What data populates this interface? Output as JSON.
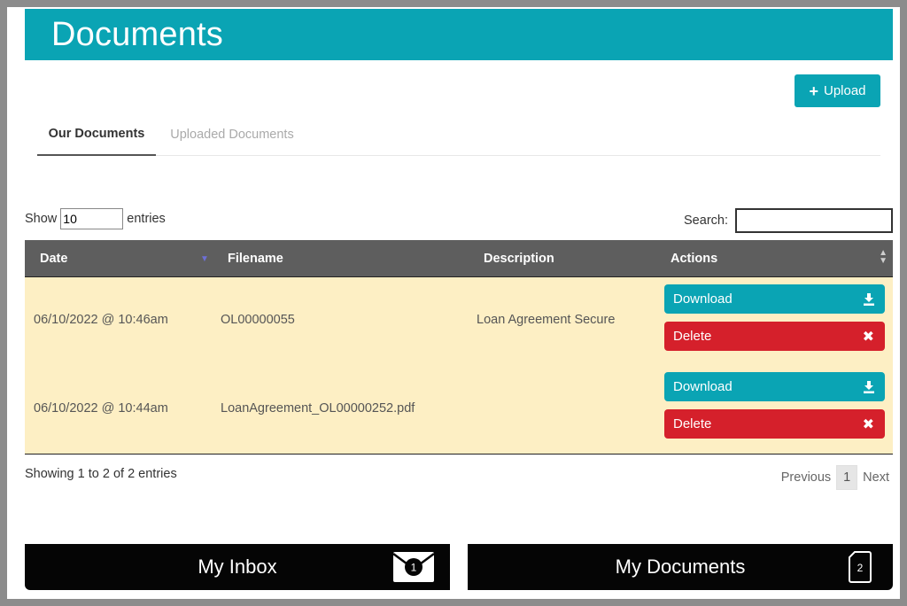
{
  "header": {
    "title": "Documents"
  },
  "toolbar": {
    "upload_label": "Upload",
    "upload_icon": "plus-icon"
  },
  "tabs": [
    {
      "label": "Our Documents",
      "active": true
    },
    {
      "label": "Uploaded Documents",
      "active": false
    }
  ],
  "table_controls": {
    "show_label": "Show",
    "show_value": "10",
    "entries_label": "entries",
    "search_label": "Search:",
    "search_value": ""
  },
  "table": {
    "columns": [
      "Date",
      "Filename",
      "Description",
      "Actions"
    ],
    "rows": [
      {
        "date": "06/10/2022 @ 10:46am",
        "filename": "OL00000055",
        "description": "Loan Agreement Secure",
        "download_label": "Download",
        "delete_label": "Delete"
      },
      {
        "date": "06/10/2022 @ 10:44am",
        "filename": "LoanAgreement_OL00000252.pdf",
        "description": "",
        "download_label": "Download",
        "delete_label": "Delete"
      }
    ]
  },
  "footer": {
    "info": "Showing 1 to 2 of 2 entries",
    "previous_label": "Previous",
    "current_page": "1",
    "next_label": "Next"
  },
  "bottom_nav": {
    "inbox_label": "My Inbox",
    "inbox_count": "1",
    "documents_label": "My Documents",
    "documents_count": "2"
  },
  "colors": {
    "accent": "#0aa4b4",
    "delete": "#d5202b",
    "row_highlight": "#fdefc4",
    "table_header": "#5e5e5e"
  }
}
